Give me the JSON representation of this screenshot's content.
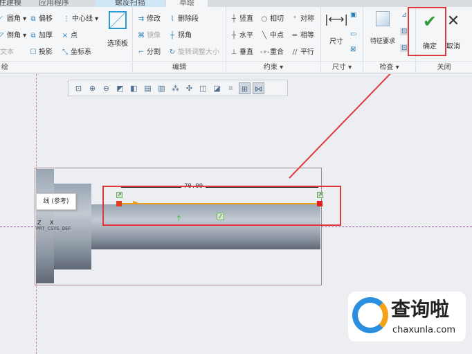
{
  "tabs": [
    "柱建模",
    "应用程序",
    "螺旋扫描",
    "草绘"
  ],
  "ribbon": {
    "sketch_group": {
      "items": [
        "圆角",
        "倒角",
        "文本",
        "偏移",
        "加厚",
        "投影",
        "中心线",
        "点",
        "坐标系"
      ],
      "palette": "选项板",
      "label": "绘"
    },
    "edit_group": {
      "items": [
        "修改",
        "删除段",
        "镜像",
        "拐角",
        "分割",
        "旋转调整大小"
      ],
      "label": "编辑"
    },
    "constrain_group": {
      "items": [
        "竖直",
        "相切",
        "对称",
        "水平",
        "中点",
        "相等",
        "垂直",
        "重合",
        "平行"
      ],
      "label": "约束"
    },
    "dimension_group": {
      "button": "尺寸",
      "label": "尺寸"
    },
    "inspect_group": {
      "button": "特征要求",
      "label": "检查"
    },
    "close_group": {
      "ok": "确定",
      "cancel": "取消",
      "label": "关闭"
    }
  },
  "canvas": {
    "tooltip": "线 (参考)",
    "dimension": "70.00",
    "csys": "PRT_CSYS_DEF",
    "csys_axes": [
      "Z",
      "X"
    ]
  },
  "watermark": {
    "brand": "查询啦",
    "url": "chaxunla.com"
  },
  "colors": {
    "accent_red": "#e0393b",
    "ok_green": "#2e9a3c",
    "sketch_line": "#f0a020"
  }
}
